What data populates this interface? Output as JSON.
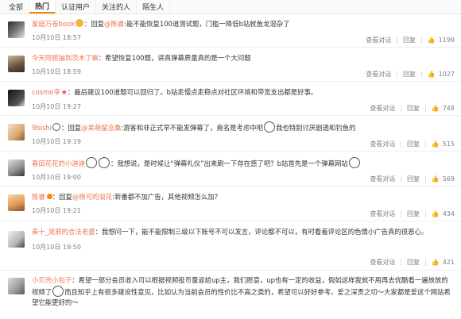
{
  "tabs": [
    "全部",
    "热门",
    "认证用户",
    "关注的人",
    "陌生人"
  ],
  "actions": {
    "reply": "回复",
    "view": "查看对话"
  },
  "comments": [
    {
      "user": "家庭万卷book",
      "reply_word": "回复",
      "mention": "@陈睿",
      "text": ":能不能恢复100道测试题，门槛一降低b站就鱼龙混杂了",
      "time": "10月10日 18:57",
      "likes": "1199"
    },
    {
      "user": "今天阿俯抽到茨木了嘛",
      "text": "：希望恢复100题，讲真弹幕质量真的是一个大问题",
      "time": "10月10日 18:59",
      "likes": "1027"
    },
    {
      "user": "cosmo亨",
      "text": "：最后建议100道题可以回归了。b站走慢点走稳点对社区环境和带宽支出都是好事。",
      "time": "10月10日 19:27",
      "likes": "748"
    },
    {
      "user": "9bishi",
      "reply_word": "回复",
      "mention": "@呆萌留念桑",
      "text": ":游客和非正式早不能发弹幕了，竟名是考虑中吧",
      "text2": "我也特别讨厌剧透和钓鱼的",
      "time": "10月10日 19:19",
      "likes": "515"
    },
    {
      "user": "春田花花的小迪迪",
      "text": "：我想说，是时候让“弹幕礼仪”出来刷一下存在感了吧？b站首先是一个弹幕网站",
      "time": "10月10日 19:00",
      "likes": "569"
    },
    {
      "user": "陈睿",
      "reply_word": "回复",
      "mention": "@杨可的浪花",
      "text": ":新番都不加广告，其他视频怎么加？",
      "time": "10月10日 19:21",
      "likes": "434"
    },
    {
      "user": "奏十_吴邪的合法老婆",
      "text": "：我想问一下，能不能限制三级以下账号不可以发言，评论都不可以，有时看着评论区的色情小广告真的很恶心。",
      "time": "10月10日 19:50",
      "likes": "421"
    },
    {
      "user": "小贝壳小包子",
      "text": "：希望一部分会员收入可以根据视频投币量返给up主，我们愿意，up也有一定的收益，假如这样我就不用再去优酷看一遍放放的视频了",
      "text2": "而且知乎上有很多建设性意见，比如认为当前会员的性价比不高之类的，希望可以好好参考。爱之深责之切～大家都是爱这个网站希望它能更好的～",
      "time": "",
      "likes": ""
    }
  ]
}
